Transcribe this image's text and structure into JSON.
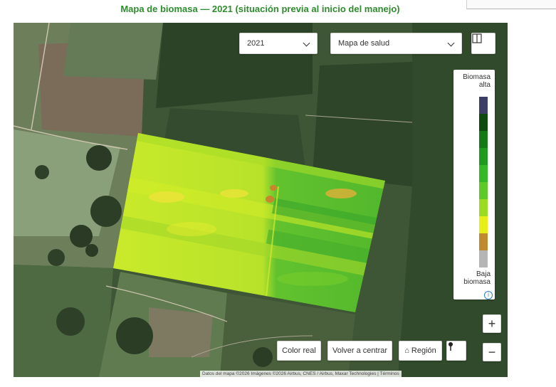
{
  "caption": "Mapa de biomasa — 2021 (situación previa al inicio del manejo)",
  "toolbar": {
    "year_select": {
      "value": "2021"
    },
    "layer_select": {
      "value": "Mapa de salud"
    }
  },
  "legend": {
    "high_label": "Biomasa alta",
    "low_label": "Baja biomasa",
    "colors": [
      "#3b3f66",
      "#0c4a10",
      "#137a16",
      "#1e9a1c",
      "#34b826",
      "#5ec928",
      "#9bdc22",
      "#e6ef18",
      "#c08a2c",
      "#b5b5b5"
    ],
    "info_icon": "info-icon"
  },
  "buttons": {
    "color_real": "Color real",
    "recenter": "Volver a centrar",
    "region": "⌂ Región",
    "zoom_in": "+",
    "zoom_out": "−"
  },
  "attribution": "Datos del mapa ©2026 Imágenes ©2026 Airbus, CNES / Airbus, Maxar Technologies  |  Términos"
}
